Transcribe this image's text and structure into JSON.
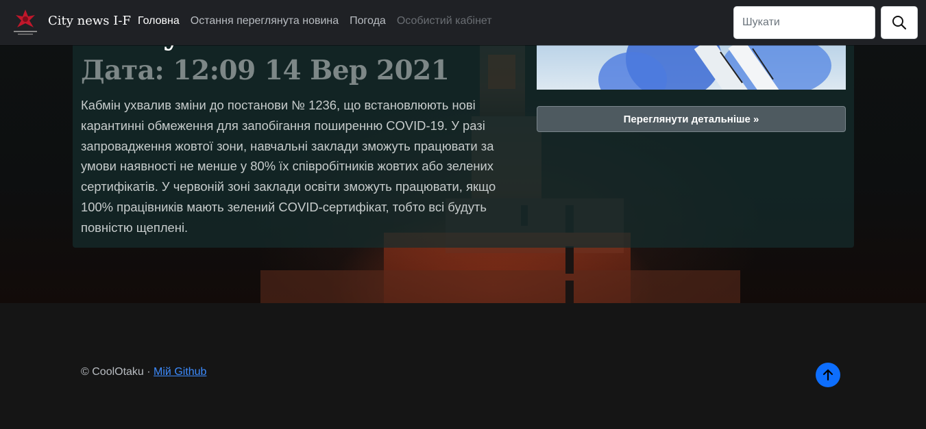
{
  "navbar": {
    "brand": "City news I-F",
    "links": [
      {
        "label": "Головна",
        "state": "active"
      },
      {
        "label": "Остання переглянута новина",
        "state": "normal"
      },
      {
        "label": "Погода",
        "state": "normal"
      },
      {
        "label": "Особистий кабінет",
        "state": "disabled"
      }
    ],
    "search_placeholder": "Шукати",
    "search_icon": "search-icon"
  },
  "article": {
    "title": "Очікуйте.",
    "date": "Дата: 12:09 14 Вер 2021",
    "text": "Кабмін ухвалив зміни до постанови № 1236, що встановлюють нові карантинні обмеження для запобігання поширенню COVID-19. У разі запровадження жовтої зони, навчальні заклади зможуть працювати за умови наявності не менше у 80% їх співробітників жовтих або зелених сертифікатів. У червоній зоні заклади освіти зможуть працювати, якщо 100% працівників мають зелений COVID-сертифікат, тобто всі будуть повністю щеплені.",
    "details_button": "Переглянути детальніше »"
  },
  "footer": {
    "copyright": "© CoolOtaku · ",
    "github_link": "Мій Github",
    "back_to_top_icon": "arrow-up-icon"
  },
  "colors": {
    "navbar_bg": "#1f2125",
    "accent": "#0d6efd",
    "link": "#3d8bfd"
  }
}
